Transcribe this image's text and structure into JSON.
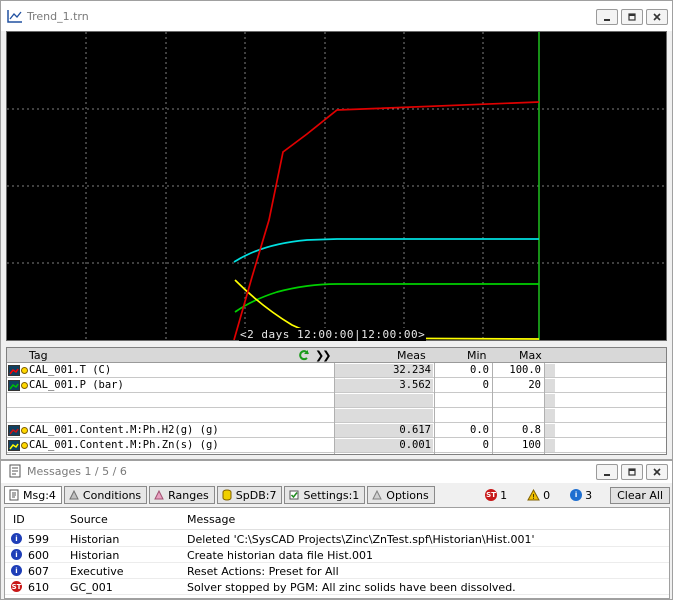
{
  "trend_window": {
    "title": "Trend_1.trn",
    "span_label": "<2 days 12:00:00|12:00:00>",
    "grid_color": "#808080",
    "cursor_color": "#1fc01f"
  },
  "tag_table": {
    "headers": {
      "tag": "Tag",
      "meas": "Meas",
      "min": "Min",
      "max": "Max"
    },
    "rows": [
      {
        "tag": "CAL_001.T (C)",
        "meas": "32.234",
        "min": "0.0",
        "max": "100.0",
        "color": "#ff0000",
        "icon": "pen-icon"
      },
      {
        "tag": "CAL_001.P (bar)",
        "meas": "3.562",
        "min": "0",
        "max": "20",
        "color": "#00c000",
        "icon": "pen-icon"
      },
      {
        "tag": "",
        "meas": "",
        "min": "",
        "max": ""
      },
      {
        "tag": "",
        "meas": "",
        "min": "",
        "max": ""
      },
      {
        "tag": "CAL_001.Content.M:Ph.H2(g) (g)",
        "meas": "0.617",
        "min": "0.0",
        "max": "0.8",
        "color": "#d01010",
        "icon": "pen-icon"
      },
      {
        "tag": "CAL_001.Content.M:Ph.Zn(s) (g)",
        "meas": "0.001",
        "min": "0",
        "max": "100",
        "color": "#ffff00",
        "icon": "pen-icon"
      }
    ]
  },
  "chart_data": {
    "type": "line",
    "title": "",
    "xlabel": "",
    "ylabel": "",
    "grid": true,
    "series": [
      {
        "name": "CAL_001.T (C)",
        "color": "#e00000"
      },
      {
        "name": "CAL_001.P (bar)",
        "color": "#00d000"
      },
      {
        "name": "CAL_001.Content.M:Ph.Zn(s) (g)",
        "color": "#ffff00"
      }
    ],
    "extra_traces": [
      {
        "color": "#00e0e0"
      }
    ]
  },
  "messages_window": {
    "title": "Messages 1 / 5 / 6",
    "tabs": [
      {
        "label": "Msg:4",
        "icon": "page-icon",
        "active": true
      },
      {
        "label": "Conditions",
        "icon": "conditions-icon",
        "active": false
      },
      {
        "label": "Ranges",
        "icon": "ranges-icon",
        "active": false
      },
      {
        "label": "SpDB:7",
        "icon": "database-icon",
        "active": false
      },
      {
        "label": "Settings:1",
        "icon": "checkbox-icon",
        "active": false
      },
      {
        "label": "Options",
        "icon": "options-icon",
        "active": false
      }
    ],
    "counters": [
      {
        "value": "1",
        "type": "error",
        "color": "#c81818"
      },
      {
        "value": "0",
        "type": "warning",
        "color": "#e8b000"
      },
      {
        "value": "3",
        "type": "info",
        "color": "#1f6fd0"
      }
    ],
    "clear_all_label": "Clear All",
    "columns": {
      "id": "ID",
      "source": "Source",
      "message": "Message"
    },
    "rows": [
      {
        "type": "info",
        "id": "599",
        "source": "Historian",
        "message": "Deleted 'C:\\SysCAD Projects\\Zinc\\ZnTest.spf\\Historian\\Hist.001'"
      },
      {
        "type": "info",
        "id": "600",
        "source": "Historian",
        "message": "Create historian data file Hist.001"
      },
      {
        "type": "info",
        "id": "607",
        "source": "Executive",
        "message": "Reset Actions: Preset for All"
      },
      {
        "type": "stop",
        "id": "610",
        "source": "GC_001",
        "message": "Solver stopped by PGM: All zinc solids have been dissolved."
      }
    ]
  }
}
